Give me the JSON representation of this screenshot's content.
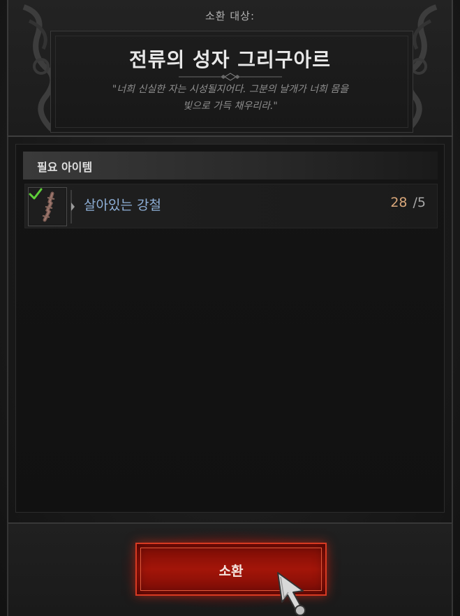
{
  "header": {
    "summon_target_label": "소환 대상:",
    "boss_name": "전류의 성자 그리구아르",
    "flavor_line1": "\"너희 신실한 자는 시성될지어다. 그분의 날개가 너희 몸을",
    "flavor_line2": "빛으로 가득 채우리라.\""
  },
  "requirements": {
    "title": "필요 아이템",
    "items": [
      {
        "name": "살아있는 강철",
        "have": "28",
        "need": "/5",
        "icon": "living-steel-icon",
        "fulfilled": true
      }
    ]
  },
  "actions": {
    "summon_label": "소환"
  },
  "colors": {
    "item_name": "#8fb0d8",
    "have_count": "#d9a77a",
    "button_red": "#a31509",
    "check_green": "#5fd03a"
  }
}
